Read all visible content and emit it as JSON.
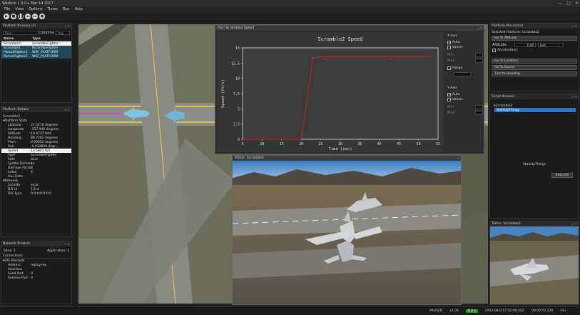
{
  "app": {
    "title": "Warlock 2.3.0+ Mar 14 2017",
    "window_controls": [
      "—",
      "□",
      "✕"
    ]
  },
  "menu": [
    "File",
    "View",
    "Options",
    "Tunes",
    "Run",
    "Help"
  ],
  "toolbar_icons": [
    "play-icon",
    "stop-icon",
    "pause-icon",
    "step-icon",
    "record-icon",
    "snapshot-icon"
  ],
  "toolbar_glyphs": [
    "▶",
    "■",
    "❚❚",
    "◂◂",
    "▸▸",
    "●"
  ],
  "platform_browser": {
    "title": "Platform Browser (4)",
    "filter_placeholder": "Filter...",
    "columns_label": "Columns",
    "columns_value": "Any",
    "headers": [
      "Name",
      "Type"
    ],
    "rows": [
      {
        "name": "Scramble2",
        "type": "ScrambleFighter"
      },
      {
        "name": "Scramble1",
        "type": "ScrambleFighter"
      },
      {
        "name": "ParkedFighter1",
        "type": "WSF_PLATFORM"
      },
      {
        "name": "ParkedFighter2",
        "type": "WSF_PLATFORM"
      }
    ]
  },
  "platform_details": {
    "title": "Platform Details",
    "name": "Scramble2",
    "stats_label": "Platform Stats",
    "stats": [
      {
        "k": "Latitude",
        "v": "21.3278 degrees"
      },
      {
        "k": "Longitude",
        "v": "-157.946 degrees"
      },
      {
        "k": "Altitude",
        "v": "10.4722 feet"
      },
      {
        "k": "Heading",
        "v": "89.7282 degrees"
      },
      {
        "k": "Pitch",
        "v": "0.60654 degrees"
      },
      {
        "k": "Roll",
        "v": "-0.012859 degr..."
      },
      {
        "k": "Speed",
        "v": "13.5843 ft/s"
      },
      {
        "k": "Type",
        "v": "ScrambleFighter"
      },
      {
        "k": "Side",
        "v": "blue"
      },
      {
        "k": "Spatial Domain",
        "v": "air"
      },
      {
        "k": "Damage Factor",
        "v": "0"
      },
      {
        "k": "Index",
        "v": "4"
      },
      {
        "k": "Aux Data",
        "v": ""
      }
    ],
    "network_label": "Network",
    "network": [
      {
        "k": "Locality",
        "v": "local"
      },
      {
        "k": "DIS Id",
        "v": "1:1:4"
      },
      {
        "k": "DIS Type",
        "v": "0:0:0:0:0:0:0"
      }
    ]
  },
  "network_browser": {
    "title": "Network Browser",
    "sites": "Sites: 1",
    "applications": "Application: 1",
    "connections_label": "Connections",
    "dis_label": "DIS (Record)",
    "rows": [
      {
        "k": "Address",
        "v": "replay.rep"
      },
      {
        "k": "Interface",
        "v": ""
      },
      {
        "k": "Send Port",
        "v": "0"
      },
      {
        "k": "Receive Port",
        "v": "0"
      }
    ]
  },
  "plot_window": {
    "title": "Plot: Scramble2 Speed",
    "x_axis_label": "X Axis",
    "y_axis_label": "Y Axis",
    "auto": "Auto",
    "values": "Values",
    "range": "Range",
    "min": "Min",
    "max": "Max"
  },
  "chart_data": {
    "type": "line",
    "title": "Scramble2 Speed",
    "xlabel": "Time (sec)",
    "ylabel": "Speed (ft/s)",
    "xlim": [
      5,
      55
    ],
    "ylim": [
      0,
      15
    ],
    "xticks": [
      5,
      10,
      15,
      20,
      25,
      30,
      35,
      40,
      45,
      50,
      55
    ],
    "yticks": [
      0,
      2.5,
      5,
      7.5,
      10,
      12.5,
      15
    ],
    "series": [
      {
        "color": "#d42020",
        "x": [
          5,
          20,
          20.5,
          23,
          26,
          30,
          35,
          40,
          45,
          50,
          53
        ],
        "y": [
          0,
          0,
          2,
          13.4,
          13.58,
          13.58,
          13.58,
          13.58,
          13.58,
          13.58,
          13.58
        ]
      }
    ],
    "markers": [
      {
        "x": 23,
        "y": 13.4
      },
      {
        "x": 26,
        "y": 13.2
      },
      {
        "x": 43,
        "y": 13.2
      }
    ],
    "grid": false
  },
  "tether_main": {
    "title": "Tether: Scramble2"
  },
  "platform_movement": {
    "title": "Platform Movement",
    "selected": "Selected Platform: Scramble2",
    "go_altitude": "Go To Altitude",
    "altitude_label": "Altitude:",
    "altitude_value": "0.00",
    "altitude_unit": "feet",
    "acceleration_label": "Acceleration:",
    "go_location": "Go To Location",
    "go_speed": "Go To Speed",
    "turn_heading": "Turn to Heading"
  },
  "script_browser": {
    "title": "Script Browser",
    "root": "Scramble2",
    "child": "StartUpThings",
    "selected_script": "StartUpThings",
    "execute": "Execute"
  },
  "tether_side": {
    "title": "Tether: Scramble1"
  },
  "status_bar": {
    "paused": "PAUSED",
    "rate": "x1.00",
    "clock": "0.0 s",
    "datetime": "2003-06-0 07:52:00.00Z",
    "time2": "00:00:52.220",
    "percent": "(%)"
  }
}
